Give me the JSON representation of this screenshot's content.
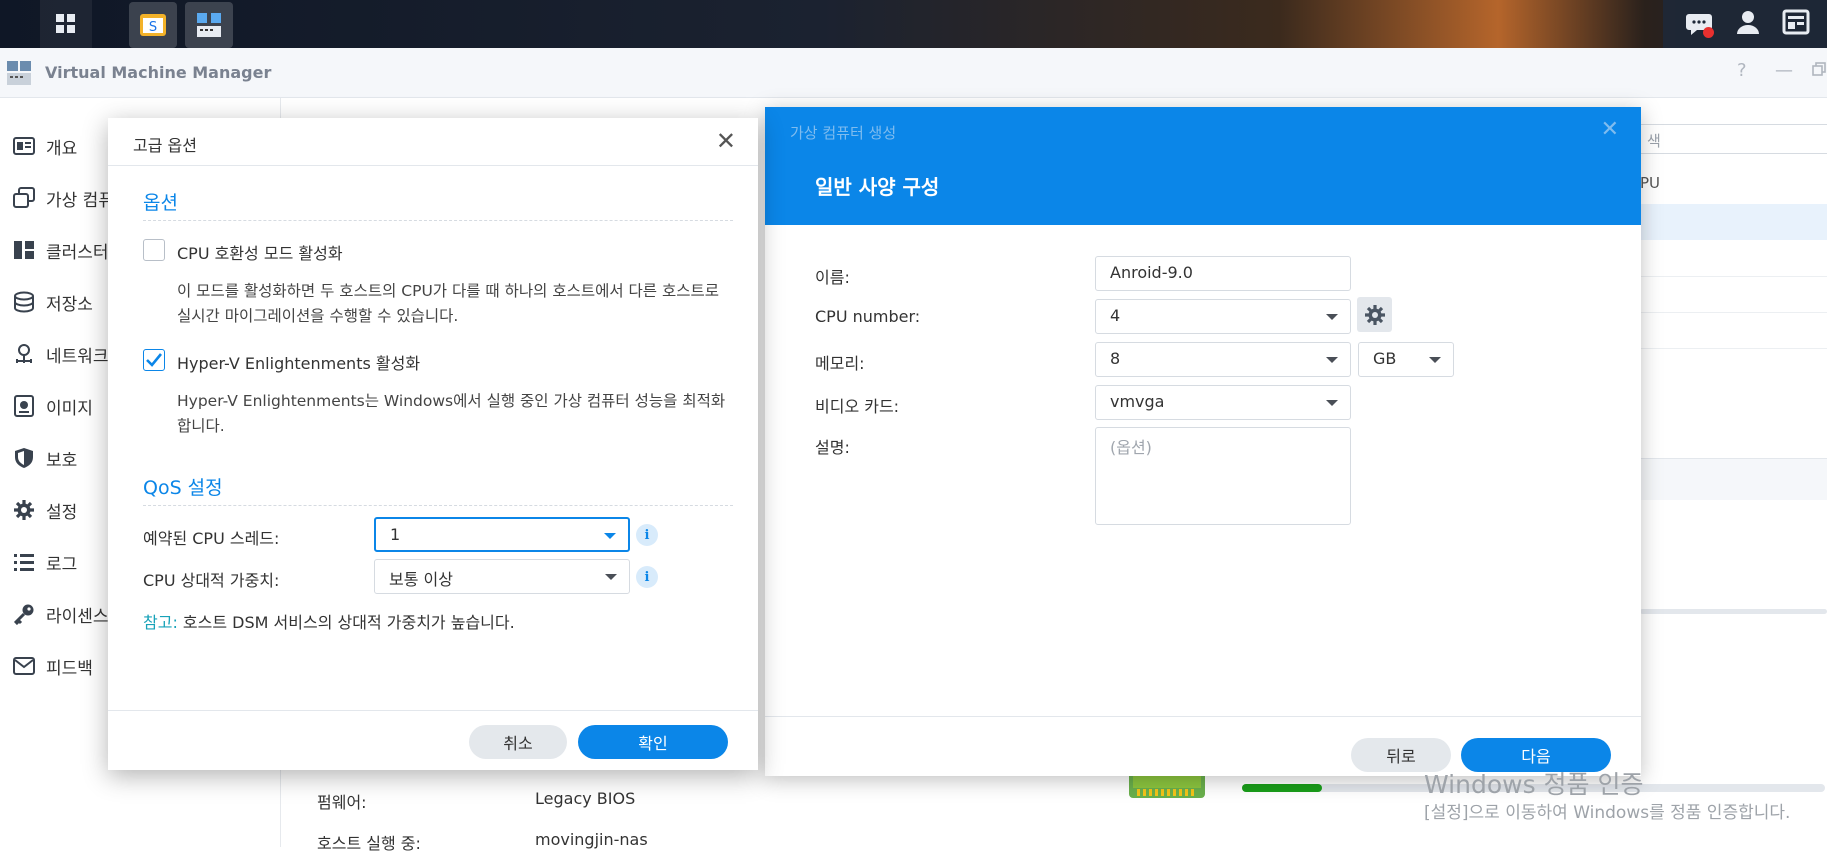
{
  "taskbar": {
    "icons": [
      "apps-grid-icon",
      "app-icon",
      "vmm-app-icon",
      "chat-icon",
      "user-icon",
      "widgets-icon"
    ]
  },
  "window": {
    "title": "Virtual Machine Manager",
    "controls": [
      "?",
      "—"
    ]
  },
  "sidebar": {
    "items": [
      {
        "label": "개요",
        "icon": "overview-icon"
      },
      {
        "label": "가상 컴퓨",
        "icon": "virtual-machine-icon"
      },
      {
        "label": "클러스터",
        "icon": "cluster-icon"
      },
      {
        "label": "저장소",
        "icon": "storage-icon"
      },
      {
        "label": "네트워크",
        "icon": "network-icon"
      },
      {
        "label": "이미지",
        "icon": "image-icon"
      },
      {
        "label": "보호",
        "icon": "shield-icon"
      },
      {
        "label": "설정",
        "icon": "gear-icon"
      },
      {
        "label": "로그",
        "icon": "list-icon"
      },
      {
        "label": "라이센스",
        "icon": "key-icon"
      },
      {
        "label": "피드백",
        "icon": "mail-icon"
      }
    ]
  },
  "background": {
    "search_partial": "색",
    "column_partial": "PU",
    "firmware_label": "펌웨어:",
    "firmware_value": "Legacy BIOS",
    "host_label": "호스트 실행 중:",
    "host_value": "movingjin-nas"
  },
  "create_vm": {
    "window_title": "가상 컴퓨터 생성",
    "step_title": "일반 사양 구성",
    "name_label": "이름:",
    "name_value": "Anroid-9.0",
    "cpu_label": "CPU number:",
    "cpu_value": "4",
    "memory_label": "메모리:",
    "memory_value": "8",
    "memory_unit": "GB",
    "video_label": "비디오 카드:",
    "video_value": "vmvga",
    "desc_label": "설명:",
    "desc_placeholder": "(옵션)",
    "back_button": "뒤로",
    "next_button": "다음"
  },
  "advanced": {
    "title": "고급 옵션",
    "options_section": "옵션",
    "cpu_compat_label": "CPU 호환성 모드 활성화",
    "cpu_compat_checked": false,
    "cpu_compat_desc": "이 모드를 활성화하면 두 호스트의 CPU가 다를 때 하나의 호스트에서 다른 호스트로 실시간 마이그레이션을 수행할 수 있습니다.",
    "hyperv_label": "Hyper-V Enlightenments 활성화",
    "hyperv_checked": true,
    "hyperv_desc": "Hyper-V Enlightenments는 Windows에서 실행 중인 가상 컴퓨터 성능을 최적화합니다.",
    "qos_section": "QoS 설정",
    "reserved_label": "예약된 CPU 스레드:",
    "reserved_value": "1",
    "weight_label": "CPU 상대적 가중치:",
    "weight_value": "보통 이상",
    "note_prefix": "참고:",
    "note_text": " 호스트 DSM 서비스의 상대적 가중치가 높습니다.",
    "cancel_button": "취소",
    "ok_button": "확인"
  },
  "watermark": {
    "line1": "Windows 정품 인증",
    "line2": "[설정]으로 이동하여 Windows를 정품 인증합니다."
  },
  "colors": {
    "accent": "#0b86e8",
    "note": "#17a2b8",
    "progress": "#1a9e1a"
  }
}
